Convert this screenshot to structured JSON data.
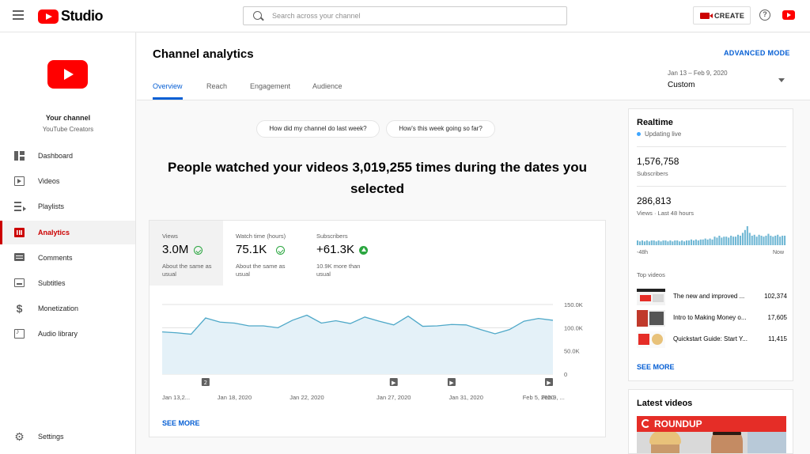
{
  "app": {
    "name": "Studio"
  },
  "search": {
    "placeholder": "Search across your channel"
  },
  "header": {
    "create_label": "CREATE",
    "help_glyph": "?"
  },
  "channel": {
    "name": "Your channel",
    "subtitle": "YouTube Creators"
  },
  "sidebar": {
    "items": [
      {
        "label": "Dashboard",
        "icon": "dashboard-icon",
        "active": false
      },
      {
        "label": "Videos",
        "icon": "videos-icon",
        "active": false
      },
      {
        "label": "Playlists",
        "icon": "playlists-icon",
        "active": false
      },
      {
        "label": "Analytics",
        "icon": "analytics-icon",
        "active": true
      },
      {
        "label": "Comments",
        "icon": "comments-icon",
        "active": false
      },
      {
        "label": "Subtitles",
        "icon": "subtitles-icon",
        "active": false
      },
      {
        "label": "Monetization",
        "icon": "dollar-icon",
        "active": false
      },
      {
        "label": "Audio library",
        "icon": "audio-library-icon",
        "active": false
      }
    ],
    "settings_label": "Settings",
    "money_glyph": "$",
    "settings_glyph": "⚙"
  },
  "main": {
    "title": "Channel analytics",
    "advanced_mode": "ADVANCED MODE",
    "tabs": [
      {
        "label": "Overview",
        "active": true
      },
      {
        "label": "Reach",
        "active": false
      },
      {
        "label": "Engagement",
        "active": false
      },
      {
        "label": "Audience",
        "active": false
      }
    ],
    "date_range": "Jan 13 – Feb 9, 2020",
    "date_preset": "Custom",
    "questions": [
      "How did my channel do last week?",
      "How's this week going so far?"
    ],
    "headline": "People watched your videos 3,019,255 times during the dates you selected",
    "metrics": [
      {
        "label": "Views",
        "value": "3.0M",
        "note": "About the same as usual",
        "status": "check",
        "selected": true
      },
      {
        "label": "Watch time (hours)",
        "value": "75.1K",
        "note": "About the same as usual",
        "status": "check",
        "selected": false
      },
      {
        "label": "Subscribers",
        "value": "+61.3K",
        "note": "10.9K more than usual",
        "status": "up",
        "selected": false
      }
    ],
    "see_more": "SEE MORE"
  },
  "chart_data": {
    "type": "area",
    "series": [
      {
        "values": [
          91000,
          89000,
          86000,
          121000,
          112000,
          110000,
          104000,
          104000,
          100000,
          116000,
          127000,
          110000,
          115000,
          109000,
          123000,
          114000,
          106000,
          125000,
          103000,
          104000,
          107000,
          106000,
          96000,
          87000,
          96000,
          114000,
          120000,
          116000
        ]
      }
    ],
    "x_tick_labels": [
      "Jan 13,2...",
      "Jan 18, 2020",
      "Jan 22, 2020",
      "Jan 27, 2020",
      "Jan 31, 2020",
      "Feb 5, 2020",
      "Feb 9, ..."
    ],
    "x_tick_index": [
      0,
      5,
      10,
      16,
      21,
      26,
      27
    ],
    "y_tick_labels": [
      "150.0K",
      "100.0K",
      "50.0K",
      "0"
    ],
    "y_ticks": [
      150000,
      100000,
      50000,
      0
    ],
    "ylim": [
      0,
      150000
    ],
    "markers": [
      {
        "index": 3,
        "label": "2"
      },
      {
        "index": 16,
        "label": "▶"
      },
      {
        "index": 20,
        "label": "▶"
      },
      {
        "index": 28,
        "label": "▶"
      }
    ],
    "colors": {
      "line": "#4ea8c8",
      "fill": "#e4f1f8",
      "grid": "#e0e0e0"
    }
  },
  "realtime": {
    "title": "Realtime",
    "status": "Updating live",
    "subscribers_value": "1,576,758",
    "subscribers_label": "Subscribers",
    "views_value": "286,813",
    "views_label": "Views · Last 48 hours",
    "axis_start": "-48h",
    "axis_end": "Now",
    "bars": [
      5,
      4,
      5,
      4,
      5,
      4,
      5,
      5,
      4,
      5,
      4,
      5,
      5,
      4,
      5,
      4,
      5,
      5,
      4,
      5,
      4,
      5,
      5,
      6,
      5,
      6,
      5,
      6,
      6,
      7,
      6,
      7,
      6,
      9,
      8,
      10,
      8,
      9,
      9,
      8,
      10,
      9,
      9,
      11,
      10,
      13,
      16,
      20,
      13,
      10,
      11,
      9,
      11,
      10,
      9,
      10,
      12,
      10,
      9,
      10,
      11,
      9,
      10,
      10
    ],
    "top_videos_title": "Top videos",
    "top_videos": [
      {
        "title": "The new and improved ...",
        "views": "102,374"
      },
      {
        "title": "Intro to Making Money o...",
        "views": "17,605"
      },
      {
        "title": "Quickstart Guide: Start Y...",
        "views": "11,415"
      }
    ],
    "see_more": "SEE MORE"
  },
  "latest_videos": {
    "title": "Latest videos",
    "banner_text": "ROUNDUP"
  },
  "colors": {
    "accent": "#065fd4",
    "brand_red": "#ff0000",
    "active_red": "#cc0000",
    "success": "#2ba640"
  }
}
